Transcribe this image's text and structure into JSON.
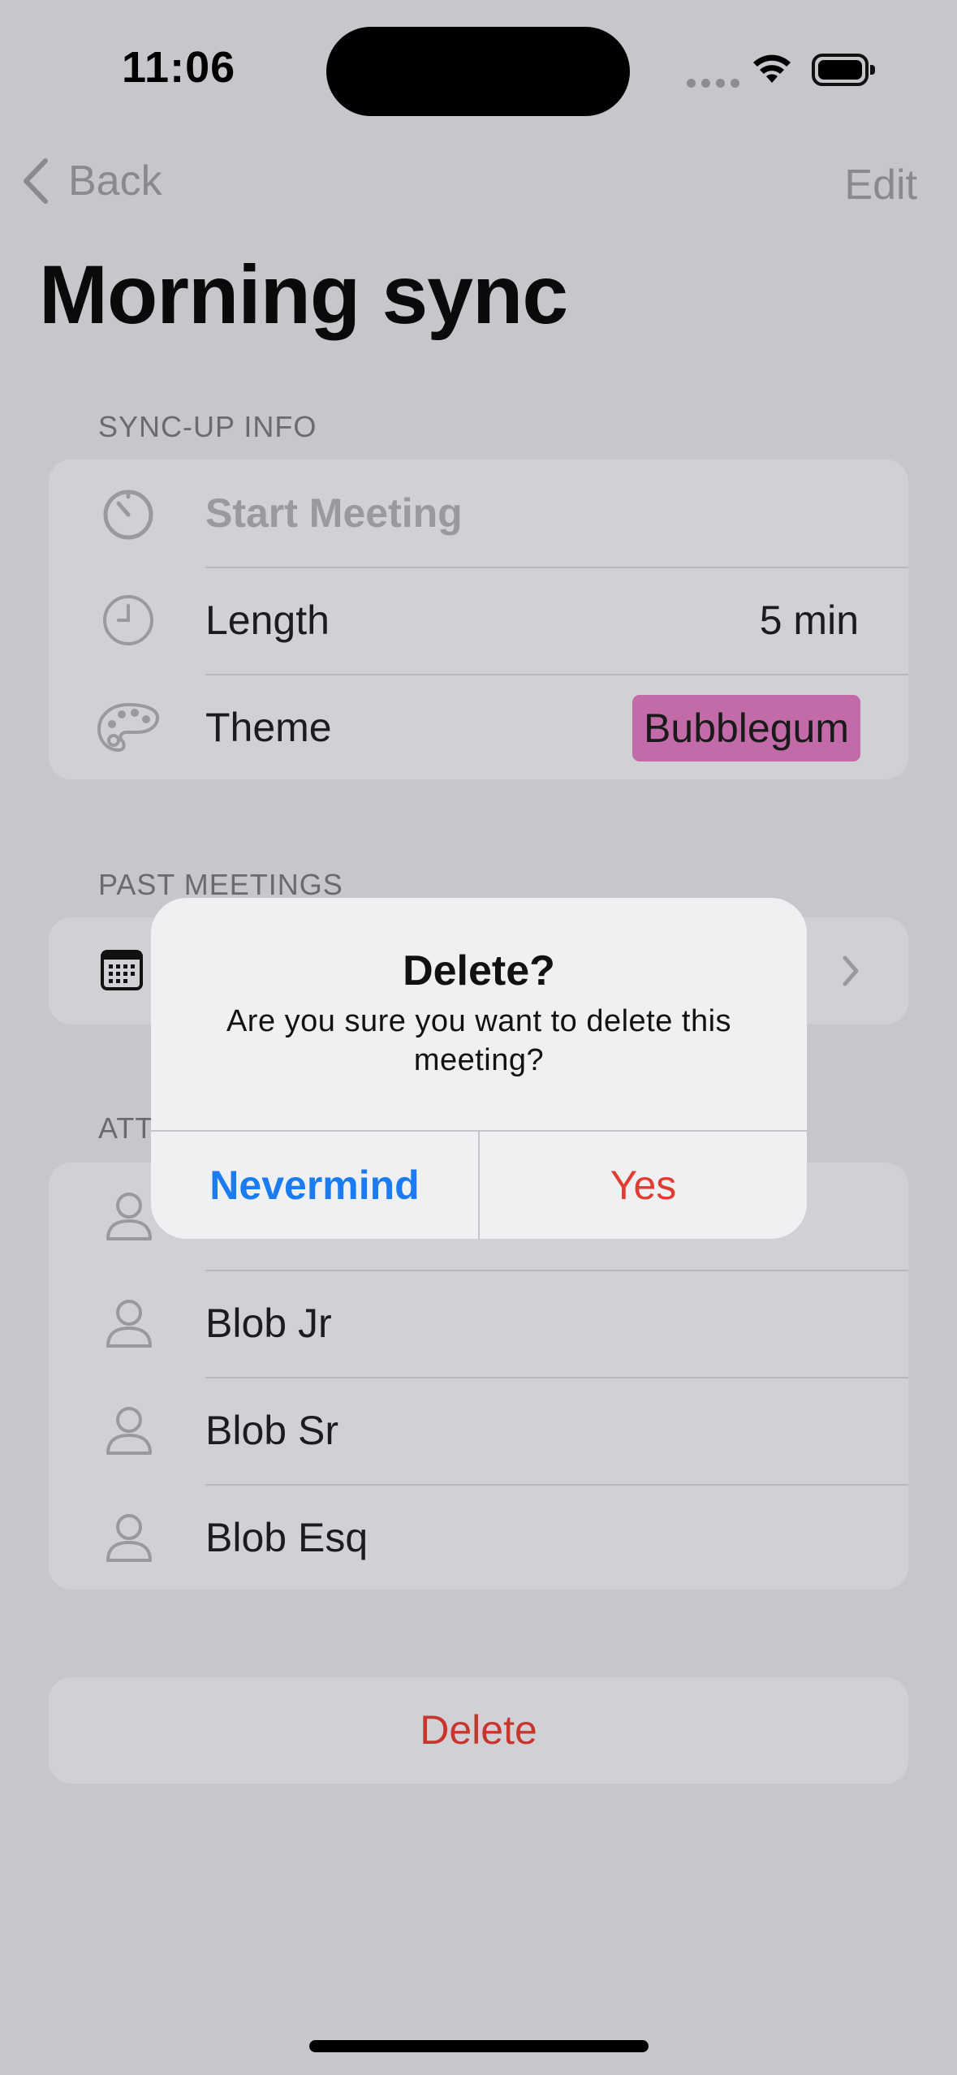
{
  "status_bar": {
    "time": "11:06"
  },
  "nav": {
    "back_label": "Back",
    "edit_label": "Edit"
  },
  "page_title": "Morning sync",
  "sync_up_info": {
    "header": "SYNC-UP INFO",
    "start_meeting_label": "Start Meeting",
    "length_label": "Length",
    "length_value": "5 min",
    "theme_label": "Theme",
    "theme_value": "Bubblegum",
    "theme_color": "#c26ba8"
  },
  "past_meetings": {
    "header": "PAST MEETINGS"
  },
  "attendees": {
    "header_visible": "ATT",
    "items": [
      "Blob Jr",
      "Blob Sr",
      "Blob Esq"
    ]
  },
  "delete_label": "Delete",
  "alert": {
    "title": "Delete?",
    "message": "Are you sure you want to delete this meeting?",
    "cancel_label": "Nevermind",
    "confirm_label": "Yes"
  },
  "colors": {
    "accent_blue": "#1a7cf0",
    "destructive_red": "#e23b31",
    "dimmed_background": "#c6c6cb"
  }
}
